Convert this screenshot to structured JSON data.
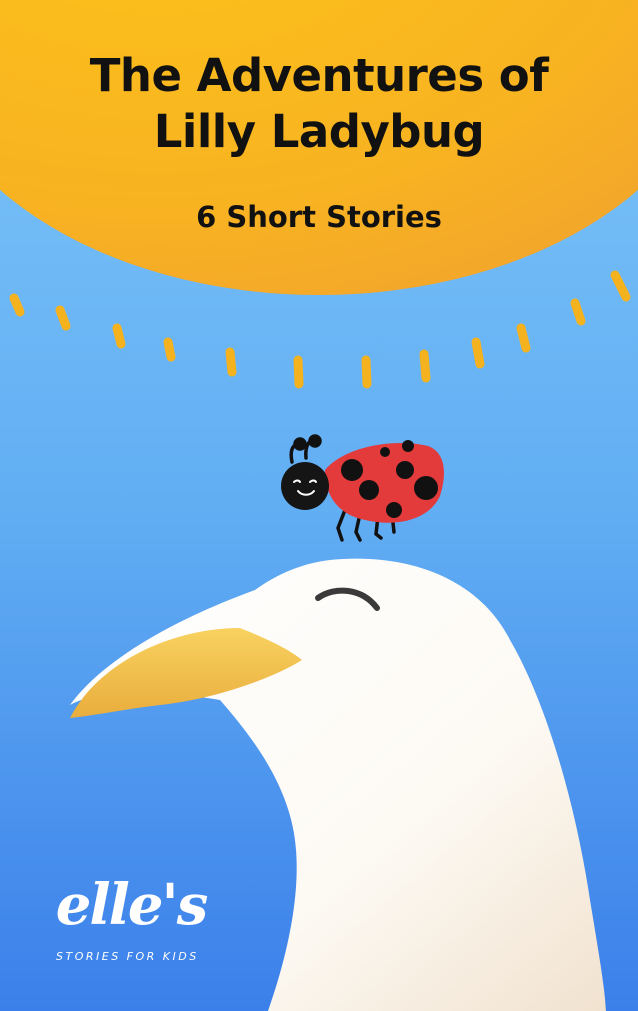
{
  "book": {
    "title_line1": "The Adventures of",
    "title_line2": "Lilly Ladybug",
    "subtitle": "6 Short Stories"
  },
  "brand": {
    "logo_text": "elle's",
    "tagline": "STORIES FOR KIDS"
  },
  "colors": {
    "sky_top": "#74bff7",
    "sky_bottom": "#3f86ec",
    "sun": "#f8ba1c",
    "ladybug_shell": "#e33a3a",
    "beak": "#f2c14a"
  }
}
